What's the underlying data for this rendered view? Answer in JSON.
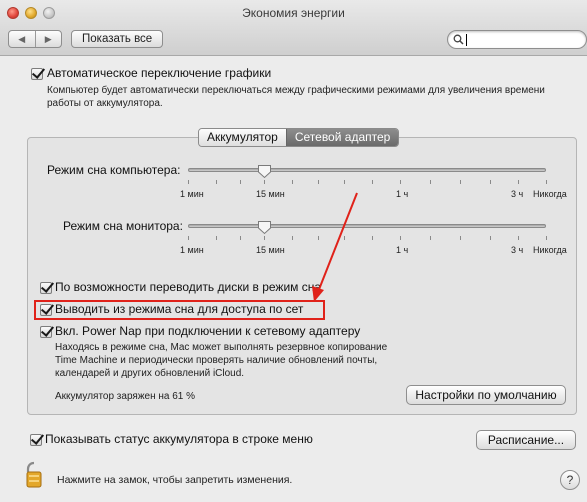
{
  "window": {
    "title": "Экономия энергии"
  },
  "toolbar": {
    "back_icon": "◀",
    "forward_icon": "▶",
    "show_all_label": "Показать все",
    "search_value": ""
  },
  "auto_graphics": {
    "checked": true,
    "label": "Автоматическое переключение графики",
    "description_line1": "Компьютер будет автоматически переключаться между графическими режимами для увеличения времени",
    "description_line2": "работы от аккумулятора."
  },
  "tabs": {
    "battery": "Аккумулятор",
    "adapter": "Сетевой адаптер",
    "selected": "Сетевой адаптер"
  },
  "computer_sleep": {
    "label": "Режим сна компьютера:",
    "ticks": {
      "min1": "1 мин",
      "min15": "15 мин",
      "hour1": "1 ч",
      "hour3": "3 ч",
      "never": "Никогда"
    },
    "value_minutes": 10
  },
  "display_sleep": {
    "label": "Режим сна монитора:",
    "ticks": {
      "min1": "1 мин",
      "min15": "15 мин",
      "hour1": "1 ч",
      "hour3": "3 ч",
      "never": "Никогда"
    },
    "value_minutes": 10
  },
  "options": {
    "disks_label": "По возможности переводить диски в режим сна",
    "disks_checked": true,
    "wake_label": "Выводить из режима сна для доступа по сет",
    "wake_checked": true,
    "powernap_label": "Вкл. Power Nap при подключении к сетевому адаптеру",
    "powernap_checked": true,
    "powernap_desc_line1": "Находясь в режиме сна, Mac может выполнять резервное копирование",
    "powernap_desc_line2": "Time Machine и периодически проверять наличие обновлений почты,",
    "powernap_desc_line3": "календарей и других обновлений iCloud."
  },
  "battery_status": "Аккумулятор заряжен на 61 %",
  "defaults_button": "Настройки по умолчанию",
  "show_battery_menu": {
    "checked": true,
    "label": "Показывать статус аккумулятора в строке меню"
  },
  "schedule_button": "Расписание...",
  "lock_text": "Нажмите на замок, чтобы запретить изменения.",
  "help_label": "?",
  "colors": {
    "annotation_red": "#e0221a",
    "active_tab": "#7a7a7a"
  }
}
